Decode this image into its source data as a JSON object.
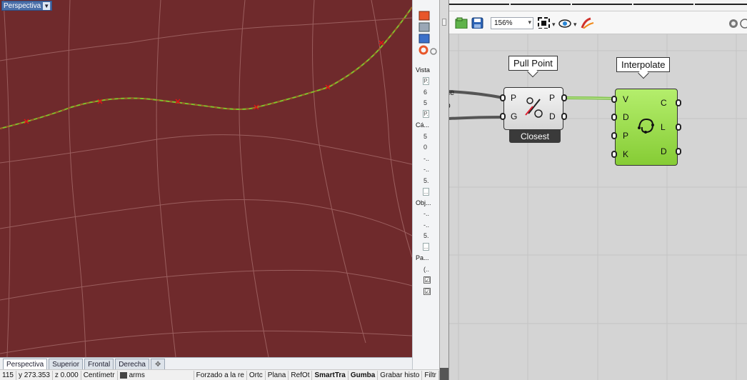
{
  "viewport": {
    "name": "Perspectiva",
    "colors": {
      "surface": "#6f2a2c",
      "grid": "#a36a6a",
      "curve_a": "#7fc22b",
      "curve_b": "#c62828",
      "marker": "#e01515"
    }
  },
  "viewport_tabs": [
    "Perspectiva",
    "Superior",
    "Frontal",
    "Derecha"
  ],
  "statusbar": {
    "x": "115",
    "y": "y 273.353",
    "z": "z 0.000",
    "units": "Centímetr",
    "layer": "arms",
    "items": [
      "Forzado a la re",
      "Ortc",
      "Plana",
      "RefOt",
      "SmartTra",
      "Gumba",
      "Grabar histo",
      "Filtr"
    ]
  },
  "properties": {
    "rows": [
      {
        "kind": "head",
        "text": "Vista"
      },
      {
        "kind": "box",
        "text": "P."
      },
      {
        "kind": "val",
        "text": "6"
      },
      {
        "kind": "val",
        "text": "5"
      },
      {
        "kind": "box",
        "text": "P."
      },
      {
        "kind": "head",
        "text": "Cá..."
      },
      {
        "kind": "val",
        "text": "5"
      },
      {
        "kind": "val",
        "text": "0"
      },
      {
        "kind": "val",
        "text": "-.."
      },
      {
        "kind": "val",
        "text": "-.."
      },
      {
        "kind": "val",
        "text": "5."
      },
      {
        "kind": "box",
        "text": "..."
      },
      {
        "kind": "head",
        "text": "Obj..."
      },
      {
        "kind": "val",
        "text": "-.."
      },
      {
        "kind": "val",
        "text": "-.."
      },
      {
        "kind": "val",
        "text": "5."
      },
      {
        "kind": "box",
        "text": "..."
      },
      {
        "kind": "head",
        "text": "Pa..."
      },
      {
        "kind": "val",
        "text": "(.."
      },
      {
        "kind": "chk",
        "text": "☑"
      },
      {
        "kind": "chk",
        "text": "☑"
      }
    ]
  },
  "grasshopper": {
    "zoom": "156%",
    "toolbar_icons": [
      "open-file-icon",
      "save-icon",
      "zoom-extents-icon",
      "preview-eye-icon",
      "sketch-brush-icon",
      "display-mode-icon"
    ],
    "cut_labels": [
      "me",
      "rp"
    ],
    "pull_point": {
      "title": "Pull Point",
      "inputs": [
        "P",
        "G"
      ],
      "outputs": [
        "P",
        "D"
      ],
      "tag": "Closest"
    },
    "interpolate": {
      "title": "Interpolate",
      "inputs": [
        "V",
        "D",
        "P",
        "K"
      ],
      "outputs": [
        "C",
        "L",
        "D"
      ]
    },
    "colors": {
      "canvas": "#d4d4d4",
      "component_grey": "#dedede",
      "component_green": "#8fd63b",
      "wire_selected": "#7ac142"
    }
  }
}
